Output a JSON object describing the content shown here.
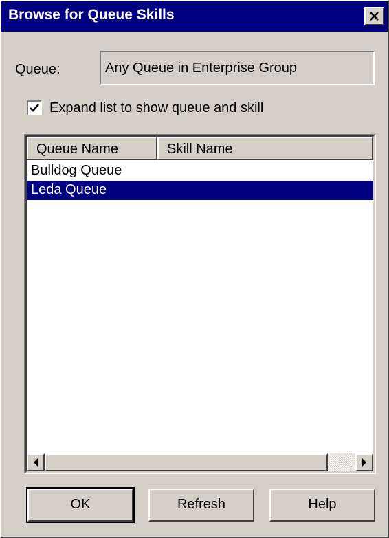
{
  "window": {
    "title": "Browse for Queue Skills"
  },
  "queue": {
    "label": "Queue:",
    "value": "Any Queue in Enterprise Group"
  },
  "expand_option": {
    "label": "Expand list to show queue and skill",
    "checked": true
  },
  "list": {
    "columns": [
      "Queue Name",
      "Skill Name"
    ],
    "rows": [
      {
        "queue_name": "Bulldog Queue",
        "skill_name": "",
        "selected": false
      },
      {
        "queue_name": "Leda Queue",
        "skill_name": "",
        "selected": true
      }
    ]
  },
  "buttons": {
    "ok": "OK",
    "refresh": "Refresh",
    "help": "Help"
  },
  "icons": {
    "close": "close-icon",
    "check": "checkmark-icon",
    "scroll_left": "arrow-left-icon",
    "scroll_right": "arrow-right-icon"
  },
  "colors": {
    "titlebar": "#000080",
    "selection": "#000080",
    "face": "#d4d0c8"
  }
}
